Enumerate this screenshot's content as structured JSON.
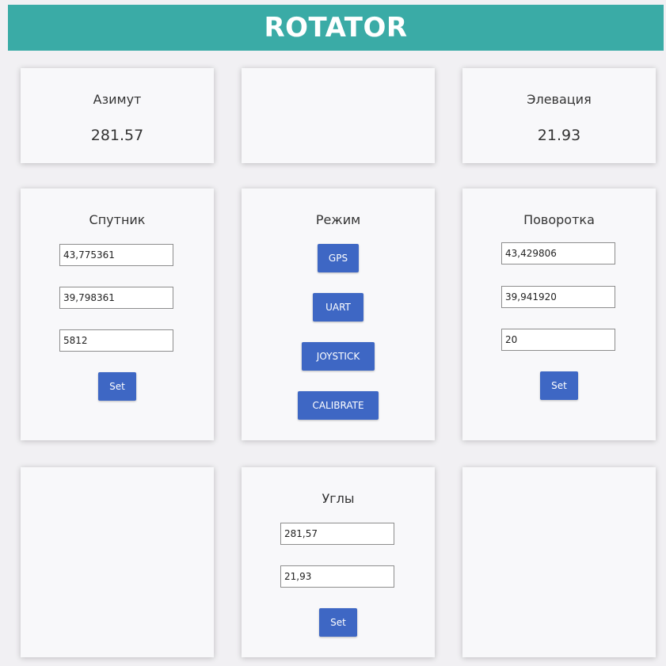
{
  "header": {
    "title": "ROTATOR",
    "color": "#3aaba6"
  },
  "azimuth": {
    "label": "Азимут",
    "value": "281.57"
  },
  "elevation": {
    "label": "Элевация",
    "value": "21.93"
  },
  "satellite": {
    "label": "Спутник",
    "lat": "43,775361",
    "lon": "39,798361",
    "alt": "5812",
    "set_label": "Set"
  },
  "mode": {
    "label": "Режим",
    "buttons": [
      "GPS",
      "UART",
      "JOYSTICK",
      "CALIBRATE"
    ]
  },
  "rotator": {
    "label": "Поворотка",
    "lat": "43,429806",
    "lon": "39,941920",
    "alt": "20",
    "set_label": "Set"
  },
  "angles": {
    "label": "Углы",
    "azimuth": "281,57",
    "elevation": "21,93",
    "set_label": "Set"
  },
  "colors": {
    "button": "#3e67c4",
    "card": "#f8f8fa",
    "background": "#f1f0f3"
  }
}
